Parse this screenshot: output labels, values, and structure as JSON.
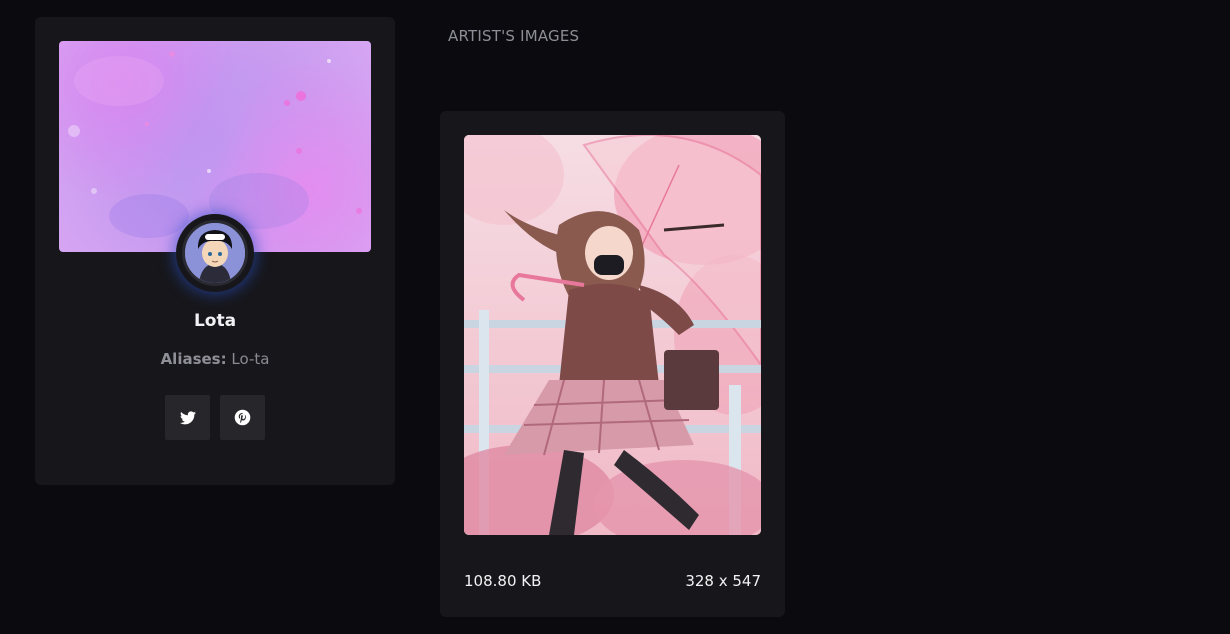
{
  "artist": {
    "name": "Lota",
    "aliases_label": "Aliases:",
    "aliases_value": "Lo-ta",
    "social": [
      {
        "label": "Twitter",
        "icon": "twitter-icon"
      },
      {
        "label": "Pinterest",
        "icon": "pinterest-icon"
      }
    ]
  },
  "images_section": {
    "title": "ARTIST'S IMAGES",
    "images": [
      {
        "file_size": "108.80 KB",
        "dimensions": "328 x 547"
      }
    ]
  },
  "colors": {
    "background": "#0b0b0f",
    "card": "#17171b",
    "social_button": "#26262b",
    "muted_text": "#8a8a92",
    "avatar_glow": "#2850c8"
  }
}
